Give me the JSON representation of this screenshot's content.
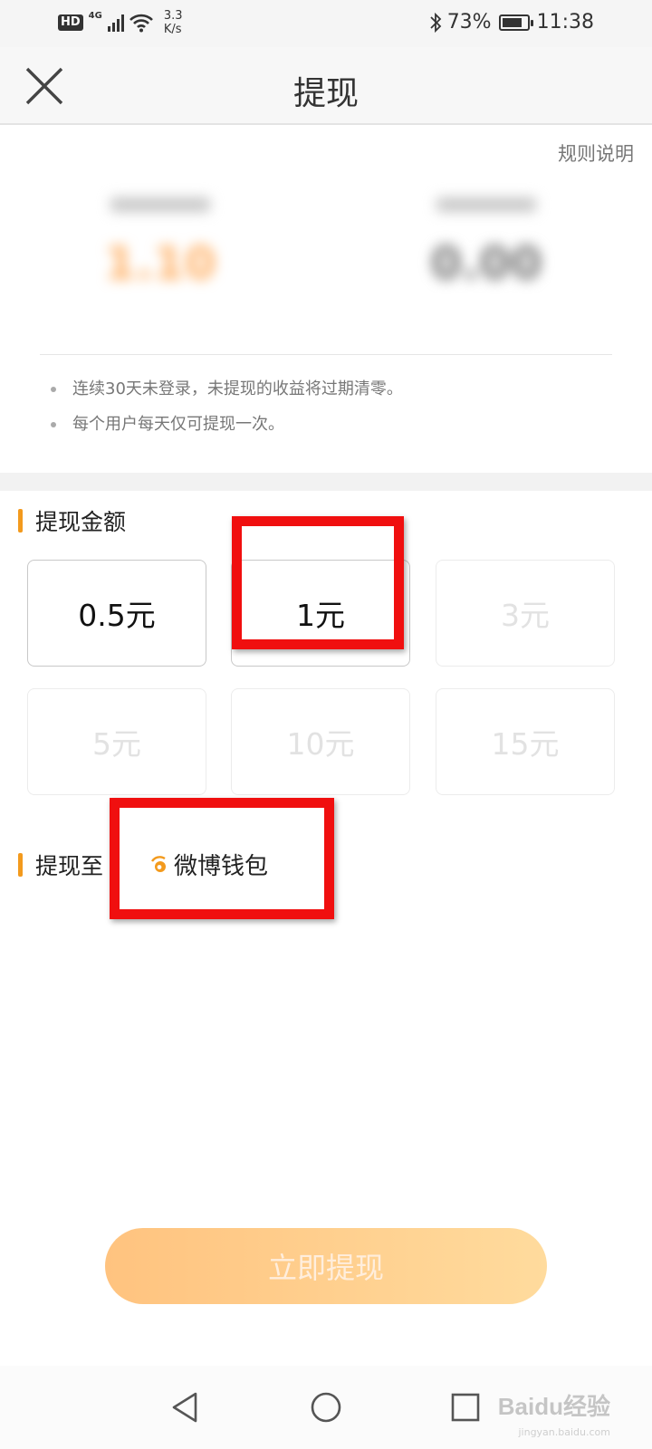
{
  "status_bar": {
    "hd": "HD",
    "network": "4G",
    "speed_value": "3.3",
    "speed_unit": "K/s",
    "battery": "73%",
    "time": "11:38"
  },
  "header": {
    "title": "提现"
  },
  "rules_link": "规则说明",
  "notes": [
    "连续30天未登录，未提现的收益将过期清零。",
    "每个用户每天仅可提现一次。"
  ],
  "amount_section": {
    "title": "提现金额",
    "options": [
      {
        "label": "0.5元",
        "enabled": true
      },
      {
        "label": "1元",
        "enabled": true
      },
      {
        "label": "3元",
        "enabled": false
      },
      {
        "label": "5元",
        "enabled": false
      },
      {
        "label": "10元",
        "enabled": false
      },
      {
        "label": "15元",
        "enabled": false
      }
    ]
  },
  "target_section": {
    "title": "提现至",
    "wallet": "微博钱包"
  },
  "submit_label": "立即提现",
  "watermark": {
    "brand": "Baidu经验",
    "url": "jingyan.baidu.com"
  },
  "colors": {
    "accent": "#f39a1d",
    "highlight": "#f00f0f",
    "button_start": "#ffc37f",
    "button_end": "#ffdb9d"
  }
}
